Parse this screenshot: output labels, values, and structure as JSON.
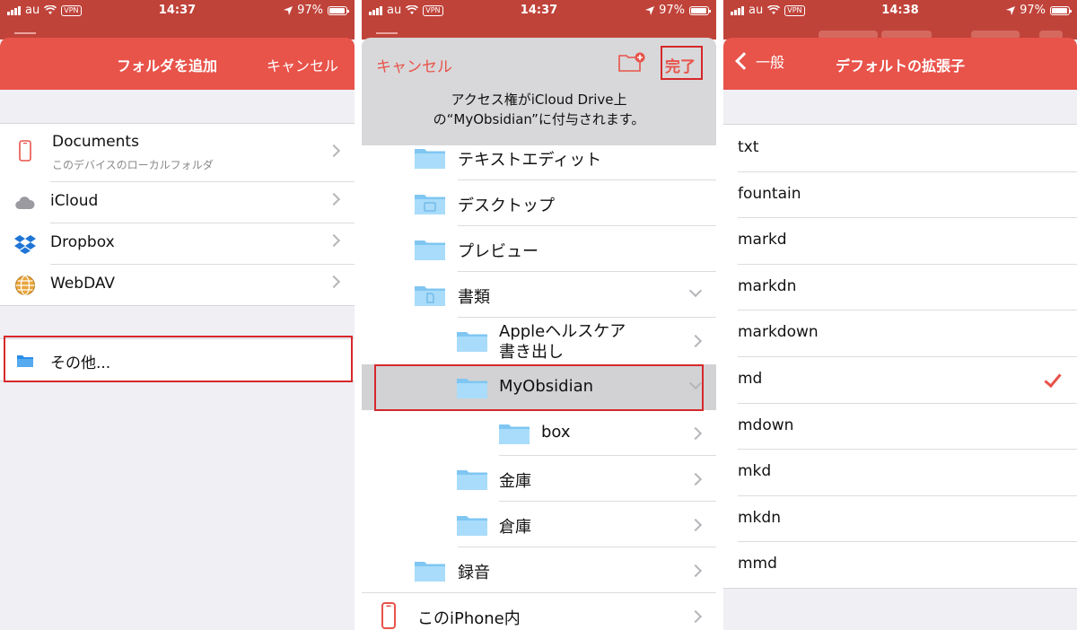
{
  "status": [
    {
      "carrier": "au",
      "vpn": "VPN",
      "time": "14:37",
      "battery": "97%"
    },
    {
      "carrier": "au",
      "vpn": "VPN",
      "time": "14:37",
      "battery": "97%"
    },
    {
      "carrier": "au",
      "vpn": "VPN",
      "time": "14:38",
      "battery": "97%"
    }
  ],
  "add_folder": {
    "title": "フォルダを追加",
    "cancel": "キャンセル",
    "sources": [
      {
        "label": "Documents",
        "sub": "このデバイスのローカルフォルダ",
        "icon": "iphone-icon"
      },
      {
        "label": "iCloud",
        "icon": "cloud-icon"
      },
      {
        "label": "Dropbox",
        "icon": "dropbox-icon"
      },
      {
        "label": "WebDAV",
        "icon": "globe-icon"
      }
    ],
    "other": {
      "label": "その他...",
      "icon": "folder-icon"
    }
  },
  "picker": {
    "cancel": "キャンセル",
    "done": "完了",
    "message_line1": "アクセス権がiCloud Drive上",
    "message_line2": "の“MyObsidian”に付与されます。",
    "folders": [
      {
        "label": "テキストエディット"
      },
      {
        "label": "デスクトップ"
      },
      {
        "label": "プレビュー"
      },
      {
        "label": "書類"
      },
      {
        "label_line1": "Appleヘルスケア",
        "label_line2": "書き出し"
      },
      {
        "label": "MyObsidian"
      },
      {
        "label": "box"
      },
      {
        "label": "金庫"
      },
      {
        "label": "倉庫"
      },
      {
        "label": "録音"
      },
      {
        "label": "このiPhone内"
      }
    ]
  },
  "extensions": {
    "back": "一般",
    "title": "デフォルトの拡張子",
    "items": [
      "txt",
      "fountain",
      "markd",
      "markdn",
      "markdown",
      "md",
      "mdown",
      "mkd",
      "mkdn",
      "mmd"
    ],
    "selected": "md"
  },
  "colors": {
    "accent": "#e8534a",
    "highlight": "#d6282b"
  }
}
